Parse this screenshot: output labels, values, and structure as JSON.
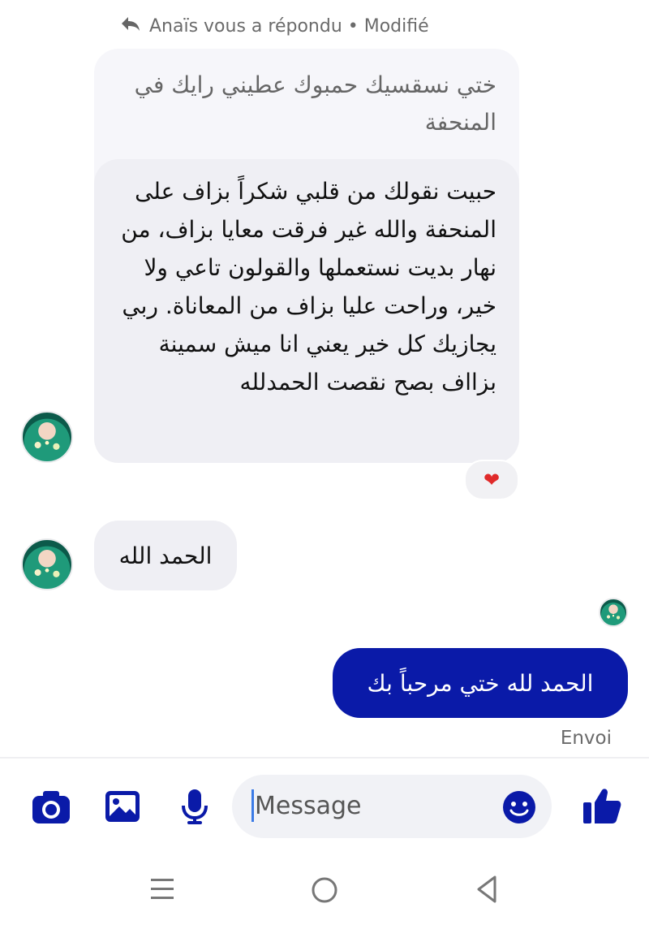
{
  "thread": {
    "reply_header": "Anaïs vous a répondu • Modifié",
    "quoted_message": "ختي نسقسيك حمبوك عطيني رايك في المنحفة",
    "messages": [
      {
        "from": "contact",
        "text": "حبيت نقولك من قلبي شكراً بزاف على المنحفة  والله غير فرقت معايا بزاف، من نهار بديت نستعملها والقولون تاعي ولا خير، وراحت عليا بزاف من المعاناة. ربي يجازيك كل خير يعني انا ميش سمينة بزااف بصح نقصت الحمدلله",
        "reaction": "❤"
      },
      {
        "from": "contact",
        "text": "الحمد الله"
      },
      {
        "from": "me",
        "text": "الحمد لله ختي مرحباً بك"
      }
    ],
    "status": "Envoi"
  },
  "composer": {
    "placeholder": "Message",
    "icons": [
      "camera-icon",
      "image-icon",
      "microphone-icon",
      "emoji-icon",
      "thumbs-up-icon"
    ]
  },
  "navbar": {
    "icons": [
      "recent-apps-icon",
      "home-icon",
      "back-icon"
    ]
  },
  "colors": {
    "accent": "#0a1aa8",
    "incoming_bubble": "#efeff4",
    "quoted_bubble": "#f6f6fa",
    "reaction": "#e02a2a"
  }
}
